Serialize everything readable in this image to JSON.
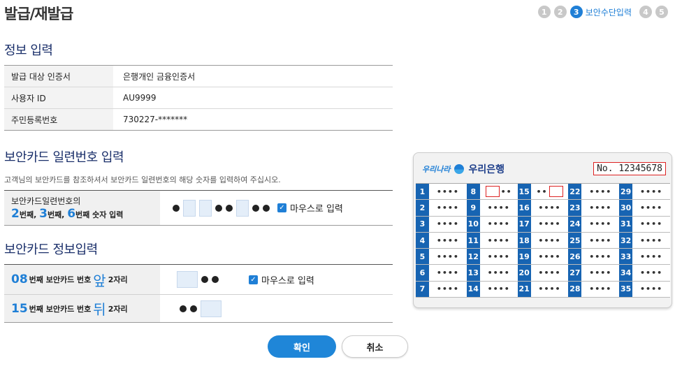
{
  "page": {
    "title": "발급/재발급"
  },
  "steps": {
    "items": [
      "1",
      "2",
      "3",
      "4",
      "5"
    ],
    "active_label": "보안수단입력"
  },
  "info": {
    "section_title": "정보 입력",
    "rows": [
      {
        "label": "발급 대상 인증서",
        "value": "은행개인 금융인증서"
      },
      {
        "label": "사용자 ID",
        "value": "AU9999"
      },
      {
        "label": "주민등록번호",
        "value": "730227-*******"
      }
    ]
  },
  "serial": {
    "section_title": "보안카드 일련번호 입력",
    "description": "고객님의 보안카드를 참조하셔서 보안카드 일련번호의 해당 숫자를 입력하여 주십시오.",
    "label_line1": "보안카드일련번호의",
    "d1": "2",
    "d1_suffix": "번째,",
    "d2": "3",
    "d2_suffix": "번째,",
    "d3": "6",
    "d3_suffix": "번째 숫자 입력",
    "mouse_label": "마우스로 입력"
  },
  "cardinfo": {
    "section_title": "보안카드 정보입력",
    "row1": {
      "num": "08",
      "mid": "번째 보안카드 번호",
      "pos": "앞",
      "suffix": "2자리"
    },
    "row2": {
      "num": "15",
      "mid": "번째 보안카드 번호",
      "pos": "뒤",
      "suffix": "2자리"
    },
    "mouse_label": "마우스로 입력"
  },
  "buttons": {
    "confirm": "확인",
    "cancel": "취소"
  },
  "security_card": {
    "brand_script": "우리나라",
    "brand_name": "우리은행",
    "serial_no": "No. 12345678",
    "numbers": [
      1,
      2,
      3,
      4,
      5,
      6,
      7,
      8,
      9,
      10,
      11,
      12,
      13,
      14,
      15,
      16,
      17,
      18,
      19,
      20,
      21,
      22,
      23,
      24,
      25,
      26,
      27,
      28,
      29,
      30,
      31,
      32,
      33,
      34,
      35
    ],
    "masked": "••••",
    "half_masked": "••"
  },
  "colors": {
    "accent": "#1f7fd6",
    "card_cell": "#1764b2",
    "highlight": "#dd2222"
  }
}
